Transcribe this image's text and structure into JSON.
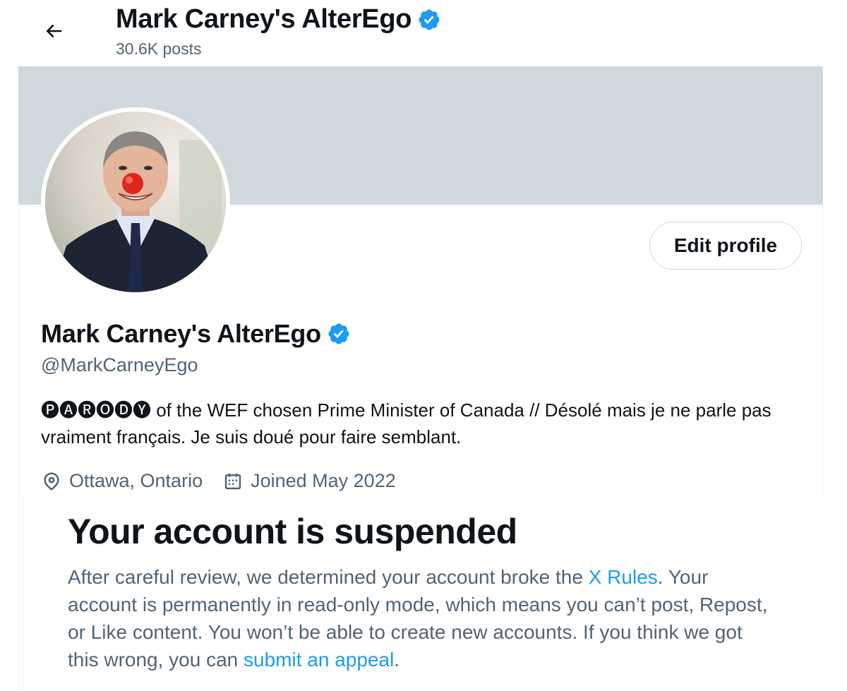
{
  "header": {
    "title": "Mark Carney's AlterEgo",
    "posts_count": "30.6K posts"
  },
  "profile": {
    "name": "Mark Carney's AlterEgo",
    "handle": "@MarkCarneyEgo",
    "bio": "🅟🅐🅡🅞🅓🅨 of the WEF chosen Prime Minister of Canada // Désolé mais je ne parle pas vraiment français. Je suis doué pour faire semblant.",
    "location": "Ottawa, Ontario",
    "joined": "Joined May 2022",
    "edit_label": "Edit profile",
    "verified": true
  },
  "suspension": {
    "title": "Your account is suspended",
    "body_part1": "After careful review, we determined your account broke the ",
    "rules_link": "X Rules",
    "body_part2": ". Your account is permanently in read-only mode, which means you can’t post, Repost, or Like content. You won’t be able to create new accounts. If you think we got this wrong, you can ",
    "appeal_link": "submit an appeal",
    "body_part3": "."
  },
  "colors": {
    "accent": "#1d9bf0",
    "banner": "#cfd9de",
    "secondary_text": "#536471"
  },
  "icons": {
    "back": "arrow-left-icon",
    "verified": "verified-badge-icon",
    "location": "location-pin-icon",
    "calendar": "calendar-icon"
  }
}
